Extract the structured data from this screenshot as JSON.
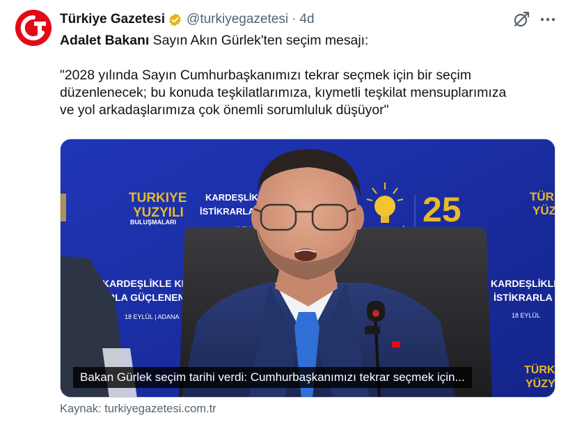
{
  "post": {
    "display_name": "Türkiye Gazetesi",
    "handle": "@turkiyegazetesi",
    "separator": "·",
    "time": "4d",
    "verified_color": "#e2b719",
    "text": {
      "line1_bold": "Adalet Bakanı",
      "line1_rest": " Sayın Akın Gürlek'ten seçim mesajı:",
      "quote_line1": "\"2028 yılında Sayın Cumhurbaşkanımızı tekrar seçmek için bir seçim",
      "quote_line2": "düzenlenecek; bu konuda teşkilatlarımıza, kıymetli teşkilat mensuplarımıza",
      "quote_line3": "ve yol arkadaşlarımıza çok önemli sorumluluk düşüyor\""
    },
    "media": {
      "caption": "Bakan Gürlek seçim tarihi verdi: Cumhurbaşkanımızı tekrar seçmek için...",
      "backdrop": {
        "turkiye": "TURKIYE",
        "yuzyili": "YUZYILI",
        "bulusmalari": "BULUŞMALARI",
        "kardeslikle_top": "KARDEŞLİKLE",
        "istikrarla": "İSTİKRARLA",
        "date_top": "18 EYL",
        "ak_parti": "AK PARTİ",
        "twentyfive": "25",
        "kardeslikle_keneti": "KARDEŞLİKLE KENETİ",
        "rla_guclenen": "RLA GÜÇLENEN",
        "eylul_adana": "18 EYLÜL | ADANA",
        "kardeslikle_right": "KARDEŞLİKLE K",
        "istikrarla_right": "İSTİKRARLA GÜÇ",
        "eylul_right": "18 EYLÜL",
        "turkiye_right": "TÜRKİYE",
        "yuzyili_right": "YÜZYIL"
      }
    },
    "source": "Kaynak: turkiyegazetesi.com.tr"
  },
  "icons": {
    "avatar": "turkiye-gazetesi-logo",
    "verified": "verified-badge-icon",
    "grok": "grok-icon",
    "more": "more-options-icon"
  },
  "colors": {
    "brand_red": "#e30a17",
    "text_primary": "#0f1419",
    "text_secondary": "#536471",
    "backdrop_blue": "#1a2ea6",
    "backdrop_gold": "#e8b92a"
  }
}
